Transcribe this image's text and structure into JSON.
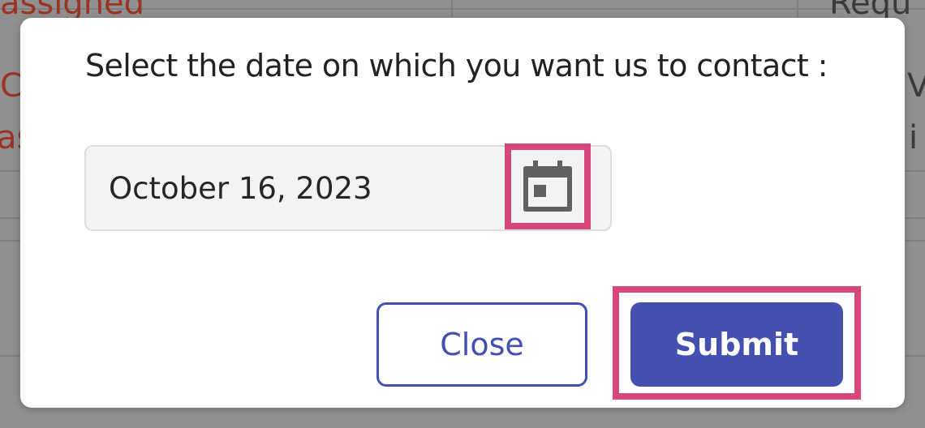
{
  "background": {
    "top_left_text": "assigned",
    "top_right_text": "Requ",
    "left_fragment_1": "C",
    "left_fragment_2": "as",
    "right_fragment_1": "V",
    "right_fragment_2": "i"
  },
  "modal": {
    "prompt": "Select the date on which you want us to contact :",
    "date_value": "October 16, 2023",
    "calendar_icon": "calendar-icon",
    "close_label": "Close",
    "submit_label": "Submit"
  },
  "colors": {
    "primary": "#4350b0",
    "highlight": "#d5477a",
    "field_background": "#f3f3f3",
    "overlay_text_red": "#9a3324"
  }
}
